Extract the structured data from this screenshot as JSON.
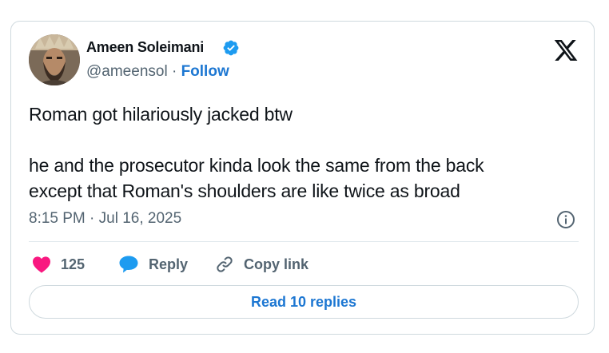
{
  "tweet": {
    "author_name": "Ameen Soleimani",
    "handle": "@ameensol",
    "separator": "·",
    "follow_label": "Follow",
    "text_line1": "Roman got hilariously jacked btw",
    "text_line2": "he and the prosecutor kinda look the same from the back",
    "text_line3": "except that Roman's shoulders are like twice as broad",
    "timestamp": "8:15 PM · Jul 16, 2025",
    "likes_count": "125",
    "reply_label": "Reply",
    "copy_link_label": "Copy link",
    "read_replies_label": "Read 10 replies"
  },
  "icons": {
    "verified": "verified-badge-icon",
    "logo": "x-logo-icon",
    "info": "info-icon",
    "like": "heart-icon",
    "reply": "speech-bubble-icon",
    "copy_link": "link-icon"
  },
  "colors": {
    "accent_blue": "#1d77d2",
    "like_pink": "#f91880",
    "reply_blue": "#1d9bf0",
    "muted_text": "#536471",
    "border": "#cfd9de"
  }
}
